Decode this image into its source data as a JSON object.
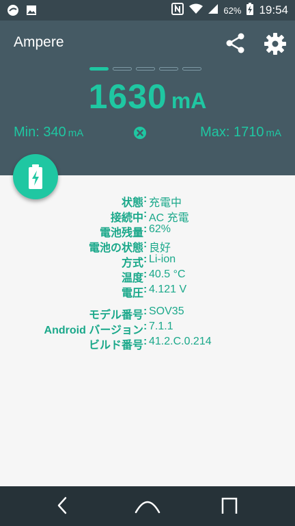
{
  "status_bar": {
    "battery_percent": "62%",
    "time": "19:54",
    "left_icons": [
      "app-notification-icon",
      "image-icon"
    ],
    "right_icons": [
      "nfc-icon",
      "wifi-icon",
      "signal-icon",
      "battery-charging-icon"
    ]
  },
  "app": {
    "title": "Ampere"
  },
  "toolbar": {
    "icons": [
      "share-icon",
      "settings-icon"
    ]
  },
  "pager": {
    "count": 5,
    "active_index": 0
  },
  "current": {
    "value": "1630",
    "unit": "mA"
  },
  "min": {
    "label": "Min:",
    "value": "340",
    "unit": "mA"
  },
  "max": {
    "label": "Max:",
    "value": "1710",
    "unit": "mA"
  },
  "info": {
    "group1": [
      {
        "label": "状態",
        "value": "充電中"
      },
      {
        "label": "接続中",
        "value": "AC 充電"
      },
      {
        "label": "電池残量",
        "value": "62%"
      },
      {
        "label": "電池の状態",
        "value": "良好"
      },
      {
        "label": "方式",
        "value": "Li-ion"
      },
      {
        "label": "温度",
        "value": "40.5 °C"
      },
      {
        "label": "電圧",
        "value": "4.121 V"
      }
    ],
    "group2": [
      {
        "label": "モデル番号",
        "value": "SOV35"
      },
      {
        "label": "Android バージョン",
        "value": "7.1.1"
      },
      {
        "label": "ビルド番号",
        "value": "41.2.C.0.214"
      }
    ],
    "separator": ":"
  },
  "colors": {
    "accent": "#1fc7a2",
    "header_bg": "#455a64",
    "status_bg": "#37474f",
    "nav_bg": "#263238",
    "body_bg": "#f6f6f6"
  },
  "navigation": {
    "icons": [
      "back-icon",
      "home-icon",
      "recents-icon"
    ]
  }
}
